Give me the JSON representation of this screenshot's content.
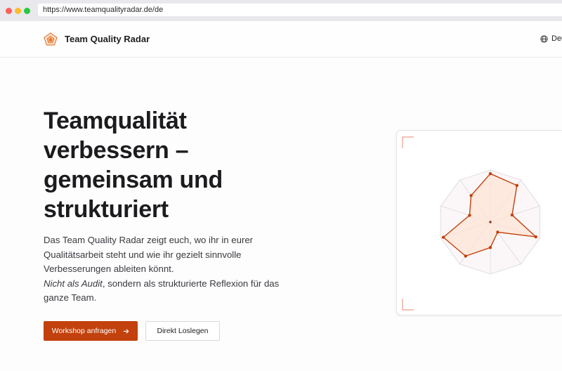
{
  "browser": {
    "url": "https://www.teamqualityradar.de/de"
  },
  "header": {
    "brand": "Team Quality Radar",
    "language_label": "Deu",
    "logo_icon": "pentagon-radar-logo-icon",
    "globe_icon": "globe-icon"
  },
  "hero": {
    "headline": "Teamqualität verbessern – gemeinsam und strukturiert",
    "lead_line1": "Das Team Quality Radar zeigt euch, wo ihr in eurer Qualitätsarbeit steht und wie ihr gezielt sinnvolle Verbesserungen ableiten könnt.",
    "lead_em": "Nicht als Audit",
    "lead_line2": ", sondern als strukturierte Reflexion für das ganze Team.",
    "primary_button": "Workshop anfragen",
    "primary_button_icon": "arrow-right-icon",
    "secondary_button": "Direkt Loslegen"
  },
  "colors": {
    "accent": "#c2410c",
    "radar_fill": "#fde4d6",
    "grid": "#d9d4dc"
  },
  "radar": {
    "axes": 10,
    "levels": 5,
    "values": [
      0.93,
      0.87,
      0.44,
      0.92,
      0.24,
      0.49,
      0.81,
      0.95,
      0.42,
      0.63
    ]
  }
}
